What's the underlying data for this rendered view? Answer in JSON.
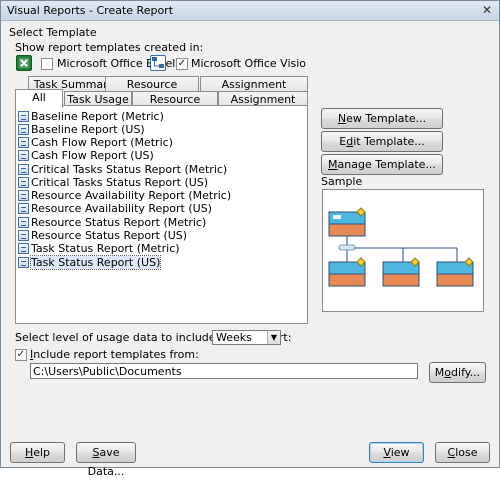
{
  "window": {
    "title": "Visual Reports - Create Report",
    "close_glyph": "✕"
  },
  "select_template": {
    "heading": "Select Template",
    "show_label": "Show report templates created in:",
    "excel": {
      "label": "Microsoft Office Excel",
      "checked": false
    },
    "visio": {
      "label": "Microsoft Office Visio",
      "checked": true
    }
  },
  "tabs": {
    "top_row": [
      "Task Summary",
      "Resource Summary",
      "Assignment Summary"
    ],
    "bottom_row": [
      "All",
      "Task Usage",
      "Resource Usage",
      "Assignment Usage"
    ],
    "active": "All"
  },
  "reports": {
    "items": [
      "Baseline Report (Metric)",
      "Baseline Report (US)",
      "Cash Flow Report (Metric)",
      "Cash Flow Report (US)",
      "Critical Tasks Status Report (Metric)",
      "Critical Tasks Status Report (US)",
      "Resource Availability Report (Metric)",
      "Resource Availability Report (US)",
      "Resource Status Report (Metric)",
      "Resource Status Report (US)",
      "Task Status Report (Metric)",
      "Task Status Report (US)"
    ],
    "selected": "Task Status Report (US)",
    "icon": "visio-report-icon"
  },
  "side_buttons": {
    "new_template": "New Template...",
    "edit_template": "Edit Template...",
    "manage_template": "Manage Template..."
  },
  "sample": {
    "label": "Sample"
  },
  "usage": {
    "label": "Select level of usage data to include in the report:",
    "value": "Weeks"
  },
  "include": {
    "label": "Include report templates from:",
    "checked": true,
    "path": "C:\\Users\\Public\\Documents",
    "modify": "Modify..."
  },
  "footer": {
    "help": "Help",
    "save_data": "Save Data...",
    "view": "View",
    "close": "Close"
  },
  "colors": {
    "node_blue": "#4fb7df",
    "node_orange": "#e98a56",
    "node_border": "#2c4f7a",
    "accent": "#3c7fb1"
  }
}
